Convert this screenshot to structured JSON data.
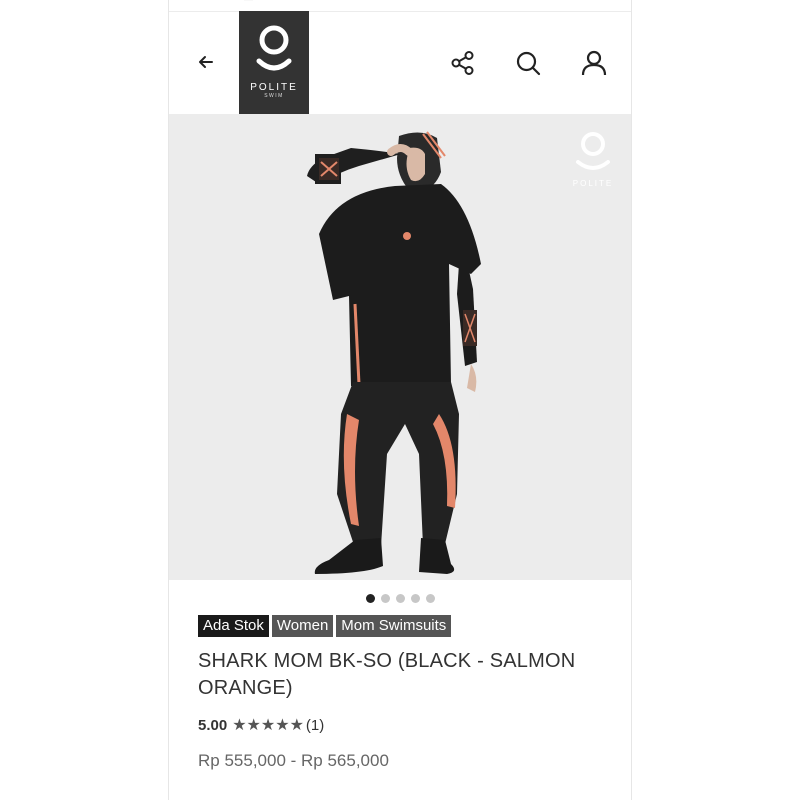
{
  "header": {
    "logo_brand": "POLITE",
    "logo_sub": "SWIM"
  },
  "icons": {
    "back": "arrow-left-icon",
    "share": "share-icon",
    "search": "search-icon",
    "account": "user-icon"
  },
  "carousel": {
    "image_watermark": "POLITE",
    "slide_count": 5,
    "active_index": 0
  },
  "product": {
    "tags": [
      "Ada Stok",
      "Women",
      "Mom Swimsuits"
    ],
    "title": "SHARK MOM BK-SO (BLACK - SALMON ORANGE)",
    "rating_score": "5.00",
    "rating_stars": "★★★★★",
    "rating_value": 5,
    "rating_count": "(1)",
    "price": "Rp 555,000 - Rp 565,000"
  },
  "colors": {
    "logo_bg": "#333333",
    "tag_stock": "#1a1a1a",
    "tag_category": "#555555",
    "accent_salmon": "#e3876a"
  }
}
